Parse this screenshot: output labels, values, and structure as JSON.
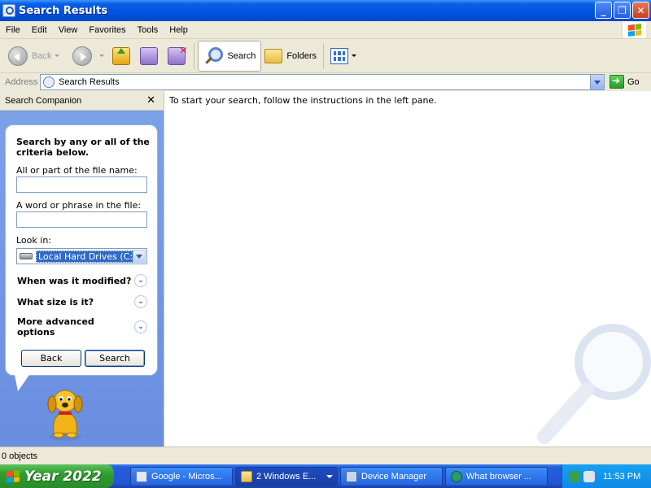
{
  "window": {
    "title": "Search Results"
  },
  "menu": [
    "File",
    "Edit",
    "View",
    "Favorites",
    "Tools",
    "Help"
  ],
  "toolbar": {
    "back": "Back",
    "search": "Search",
    "folders": "Folders"
  },
  "address": {
    "label": "Address",
    "value": "Search Results",
    "go": "Go"
  },
  "companion": {
    "header": "Search Companion",
    "heading": "Search by any or all of the criteria below.",
    "filename_label": "All or part of the file name:",
    "filename_value": "",
    "phrase_label": "A word or phrase in the file:",
    "phrase_value": "",
    "lookin_label": "Look in:",
    "lookin_value": "Local Hard Drives (C:)",
    "options": [
      "When was it modified?",
      "What size is it?",
      "More advanced options"
    ],
    "back_button": "Back",
    "search_button": "Search"
  },
  "results": {
    "instructions": "To start your search, follow the instructions in the left pane."
  },
  "status": {
    "text": "0 objects"
  },
  "taskbar": {
    "start": "Year 2022",
    "tasks": [
      "Google - Micros...",
      "2 Windows E...",
      "Device Manager",
      "What browser ..."
    ],
    "clock": "11:53 PM"
  },
  "colors": {
    "titlebar": "#0053e1",
    "selection": "#316ac5",
    "start": "#2f9d2f",
    "taskbar": "#2356d4"
  }
}
